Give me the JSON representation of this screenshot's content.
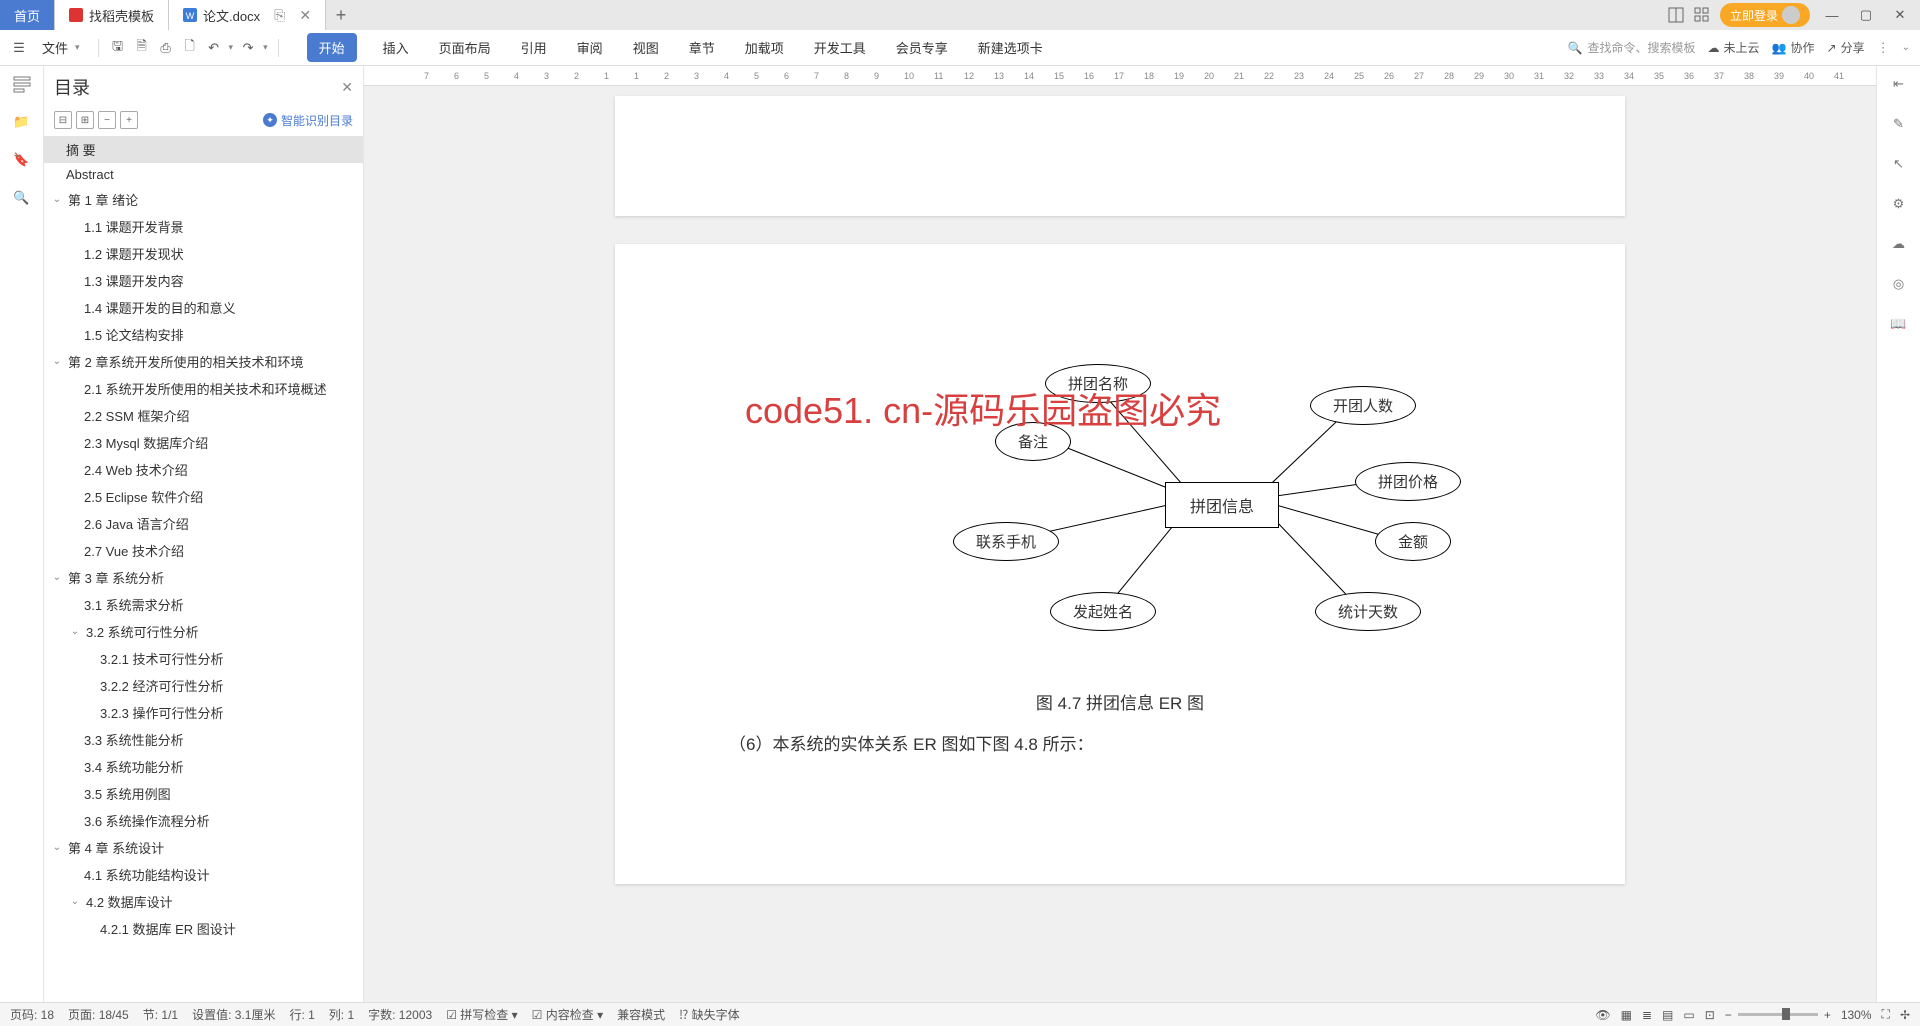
{
  "tabs": {
    "home": "首页",
    "app": "找稻壳模板",
    "doc": "论文.docx"
  },
  "login": "立即登录",
  "file_menu": "文件",
  "ribbon": [
    "开始",
    "插入",
    "页面布局",
    "引用",
    "审阅",
    "视图",
    "章节",
    "加载项",
    "开发工具",
    "会员专享",
    "新建选项卡"
  ],
  "search_ph": "查找命令、搜索模板",
  "cloud": "未上云",
  "collab": "协作",
  "share": "分享",
  "outline": {
    "title": "目录",
    "smart": "智能识别目录",
    "items": [
      {
        "lvl": 0,
        "txt": "摘 要",
        "sel": true
      },
      {
        "lvl": 0,
        "txt": "Abstract"
      },
      {
        "lvl": 1,
        "txt": "第 1 章 绪论",
        "exp": true
      },
      {
        "lvl": 2,
        "txt": "1.1 课题开发背景"
      },
      {
        "lvl": 2,
        "txt": "1.2 课题开发现状"
      },
      {
        "lvl": 2,
        "txt": "1.3 课题开发内容"
      },
      {
        "lvl": 2,
        "txt": "1.4 课题开发的目的和意义"
      },
      {
        "lvl": 2,
        "txt": "1.5 论文结构安排"
      },
      {
        "lvl": 1,
        "txt": "第 2 章系统开发所使用的相关技术和环境",
        "exp": true
      },
      {
        "lvl": 2,
        "txt": "2.1 系统开发所使用的相关技术和环境概述"
      },
      {
        "lvl": 2,
        "txt": "2.2 SSM 框架介绍"
      },
      {
        "lvl": 2,
        "txt": "2.3 Mysql 数据库介绍"
      },
      {
        "lvl": 2,
        "txt": "2.4 Web 技术介绍"
      },
      {
        "lvl": 2,
        "txt": "2.5 Eclipse 软件介绍"
      },
      {
        "lvl": 2,
        "txt": "2.6 Java 语言介绍"
      },
      {
        "lvl": 2,
        "txt": "2.7 Vue 技术介绍"
      },
      {
        "lvl": 1,
        "txt": "第 3 章  系统分析",
        "exp": true
      },
      {
        "lvl": 2,
        "txt": "3.1 系统需求分析"
      },
      {
        "lvl": 2,
        "txt": "3.2 系统可行性分析",
        "exp": true
      },
      {
        "lvl": 3,
        "txt": "3.2.1 技术可行性分析"
      },
      {
        "lvl": 3,
        "txt": "3.2.2 经济可行性分析"
      },
      {
        "lvl": 3,
        "txt": "3.2.3 操作可行性分析"
      },
      {
        "lvl": 2,
        "txt": "3.3 系统性能分析"
      },
      {
        "lvl": 2,
        "txt": "3.4  系统功能分析"
      },
      {
        "lvl": 2,
        "txt": "3.5 系统用例图"
      },
      {
        "lvl": 2,
        "txt": "3.6 系统操作流程分析"
      },
      {
        "lvl": 1,
        "txt": "第 4 章  系统设计",
        "exp": true
      },
      {
        "lvl": 2,
        "txt": "4.1 系统功能结构设计"
      },
      {
        "lvl": 2,
        "txt": "4.2 数据库设计",
        "exp": true
      },
      {
        "lvl": 3,
        "txt": "4.2.1 数据库 ER 图设计"
      }
    ]
  },
  "doc": {
    "watermark": "code51. cn-源码乐园盗图必究",
    "er_center": "拼团信息",
    "er_attrs": [
      "拼团名称",
      "备注",
      "联系手机",
      "发起姓名",
      "开团人数",
      "拼团价格",
      "金额",
      "统计天数"
    ],
    "caption": "图 4.7 拼团信息 ER 图",
    "body": "（6）本系统的实体关系 ER 图如下图 4.8 所示："
  },
  "ruler_nums": [
    "7",
    "6",
    "5",
    "4",
    "3",
    "2",
    "1",
    "1",
    "2",
    "3",
    "4",
    "5",
    "6",
    "7",
    "8",
    "9",
    "10",
    "11",
    "12",
    "13",
    "14",
    "15",
    "16",
    "17",
    "18",
    "19",
    "20",
    "21",
    "22",
    "23",
    "24",
    "25",
    "26",
    "27",
    "28",
    "29",
    "30",
    "31",
    "32",
    "33",
    "34",
    "35",
    "36",
    "37",
    "38",
    "39",
    "40",
    "41"
  ],
  "status": {
    "page_no": "页码: 18",
    "page": "页面: 18/45",
    "sect": "节: 1/1",
    "setval": "设置值: 3.1厘米",
    "line": "行: 1",
    "col": "列: 1",
    "words": "字数: 12003",
    "spell": "拼写检查",
    "content": "内容检查",
    "compat": "兼容模式",
    "missfont": "缺失字体",
    "zoom": "130%"
  }
}
